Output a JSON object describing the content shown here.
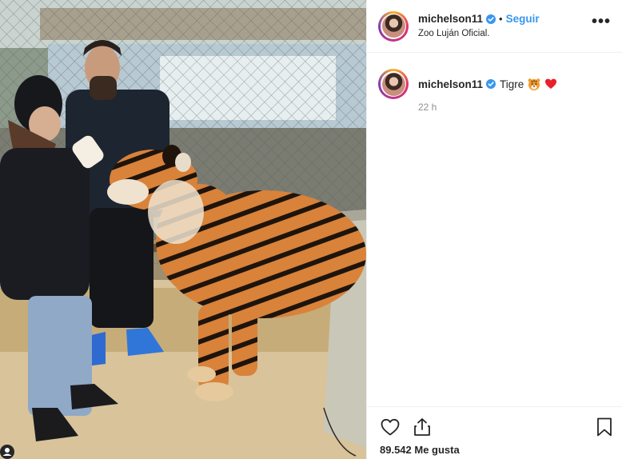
{
  "post": {
    "username": "michelson11",
    "follow_label": "Seguir",
    "separator": "•",
    "location": "Zoo Luján Oficial.",
    "more_label": "•••",
    "caption": {
      "username": "michelson11",
      "text": "Tigre"
    },
    "time_ago": "22 h",
    "likes": "89.542 Me gusta"
  },
  "icons": {
    "verified": "verified-badge-icon",
    "tiger_emoji": "tiger-face-emoji",
    "heart_emoji": "red-heart-emoji",
    "like": "heart-outline-icon",
    "share": "share-upload-icon",
    "save": "bookmark-icon"
  },
  "colors": {
    "link_blue": "#3897f0",
    "verified_blue": "#3897f0",
    "text": "#262626",
    "muted": "#8e8e8e",
    "border": "#efefef"
  }
}
